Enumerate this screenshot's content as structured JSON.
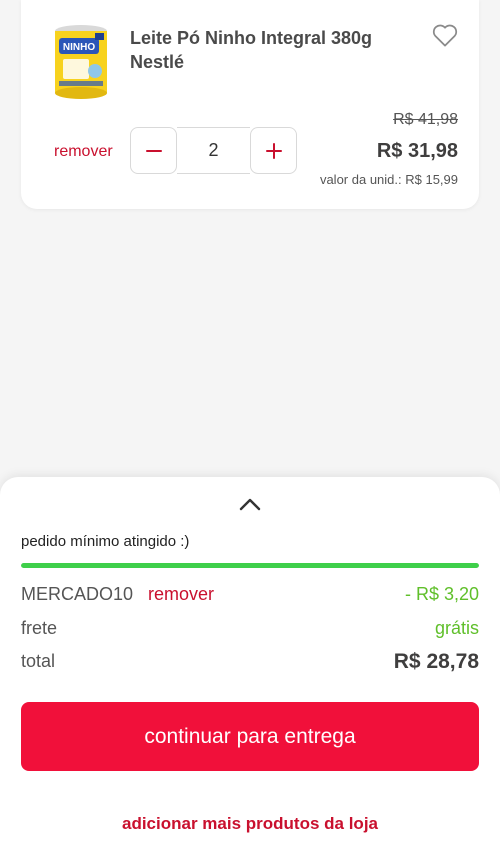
{
  "product": {
    "name": "Leite Pó Ninho Integral 380g Nestlé",
    "image_icon": "ninho-milk-can",
    "favorite_icon": "heart-outline-icon",
    "remove_label": "remover",
    "quantity": "2",
    "old_price": "R$ 41,98",
    "price": "R$ 31,98",
    "unit_price": "valor da unid.: R$ 15,99"
  },
  "summary": {
    "min_order_text": "pedido mínimo atingido :)",
    "progress_fraction": 1.0,
    "coupon": {
      "code": "MERCADO10",
      "remove_label": "remover",
      "discount": "- R$ 3,20"
    },
    "freight": {
      "label": "frete",
      "value": "grátis"
    },
    "total": {
      "label": "total",
      "value": "R$ 28,78"
    },
    "continue_label": "continuar para entrega",
    "add_more_label": "adicionar mais produtos da loja"
  },
  "colors": {
    "brand_red": "#f1103a",
    "link_red": "#c9102e",
    "success_green": "#5fbf2a",
    "progress_green": "#3ecf4a"
  }
}
